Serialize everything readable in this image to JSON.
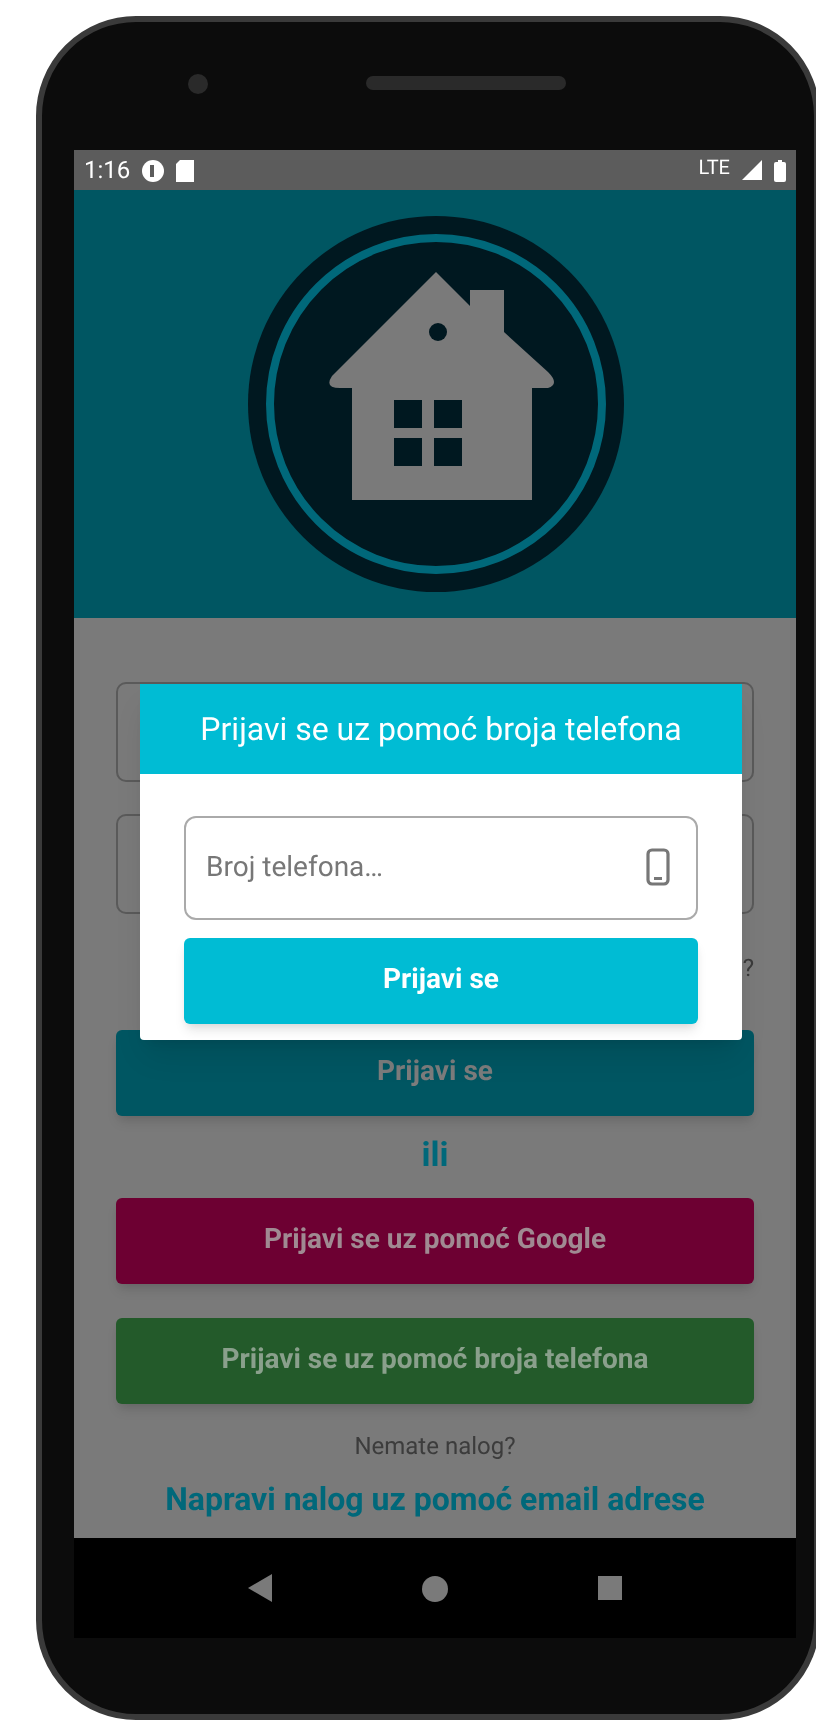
{
  "status_bar": {
    "time": "1:16",
    "network": "LTE"
  },
  "login_form": {
    "forgot_password_fragment": "?",
    "login_button": "Prijavi se",
    "separator": "ili",
    "google_button": "Prijavi se uz pomoć Google",
    "phone_button": "Prijavi se uz pomoć broja telefona",
    "signup_prompt": "Nemate nalog?",
    "signup_link": "Napravi nalog uz pomoć email adrese"
  },
  "dialog": {
    "title": "Prijavi se uz pomoć broja telefona",
    "phone_field": {
      "placeholder": "Broj telefona…"
    },
    "submit_button": "Prijavi se"
  }
}
